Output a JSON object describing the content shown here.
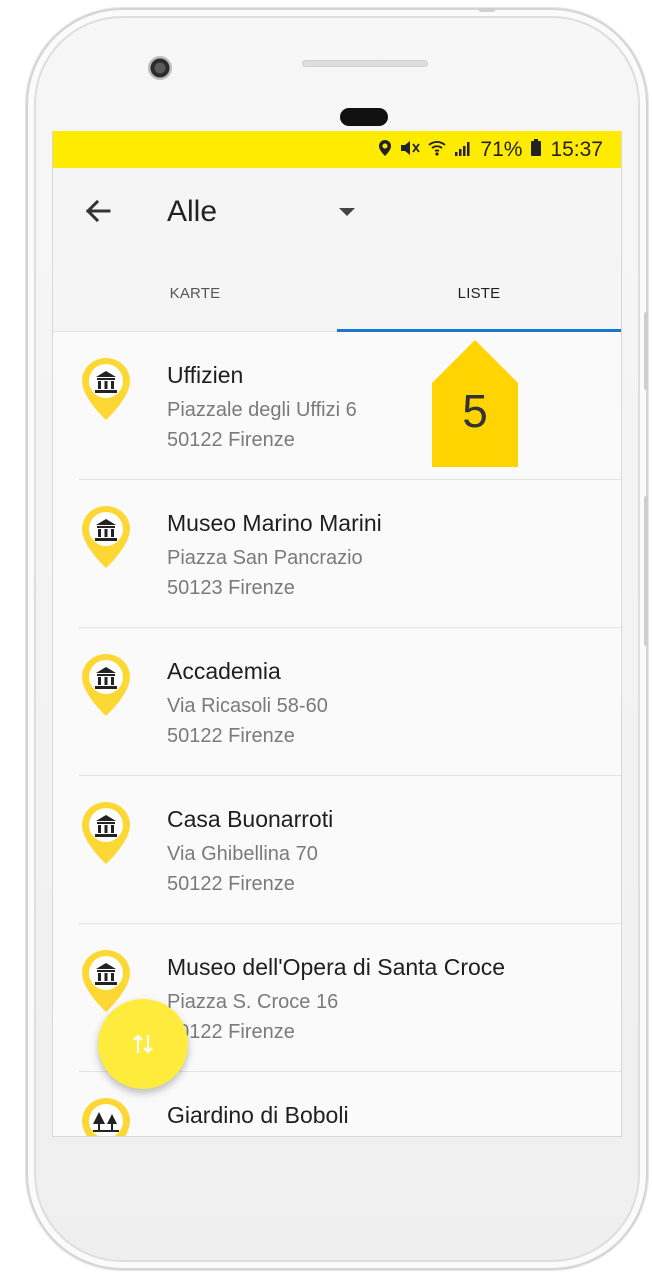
{
  "status_bar": {
    "battery": "71%",
    "time": "15:37",
    "icons": [
      "location-icon",
      "mute-icon",
      "wifi-icon",
      "signal-icon",
      "battery-icon"
    ]
  },
  "app_bar": {
    "title": "Alle",
    "back_icon": "arrow-left-icon",
    "dropdown_icon": "dropdown-arrow-icon"
  },
  "tabs": [
    {
      "label": "KARTE",
      "active": false
    },
    {
      "label": "LISTE",
      "active": true
    }
  ],
  "places": [
    {
      "name": "Uffizien",
      "street": "Piazzale degli Uffizi 6",
      "city": "50122 Firenze",
      "icon": "museum-icon"
    },
    {
      "name": "Museo Marino Marini",
      "street": "Piazza San Pancrazio",
      "city": "50123 Firenze",
      "icon": "museum-icon"
    },
    {
      "name": "Accademia",
      "street": "Via Ricasoli 58-60",
      "city": "50122 Firenze",
      "icon": "museum-icon"
    },
    {
      "name": "Casa Buonarroti",
      "street": "Via Ghibellina 70",
      "city": "50122 Firenze",
      "icon": "museum-icon"
    },
    {
      "name": "Museo dell'Opera di Santa Croce",
      "street": "Piazza S. Croce 16",
      "city": "50122 Firenze",
      "icon": "museum-icon"
    },
    {
      "name": "Giardino di Boboli",
      "street": "",
      "city": "",
      "icon": "park-icon"
    }
  ],
  "fab": {
    "icon": "sort-icon"
  },
  "annotation": {
    "label": "5"
  },
  "colors": {
    "status_bar": "#ffeb00",
    "pin": "#fdd835",
    "tab_indicator": "#1976d2",
    "fab": "#ffeb3b",
    "annotation": "#ffd400"
  }
}
